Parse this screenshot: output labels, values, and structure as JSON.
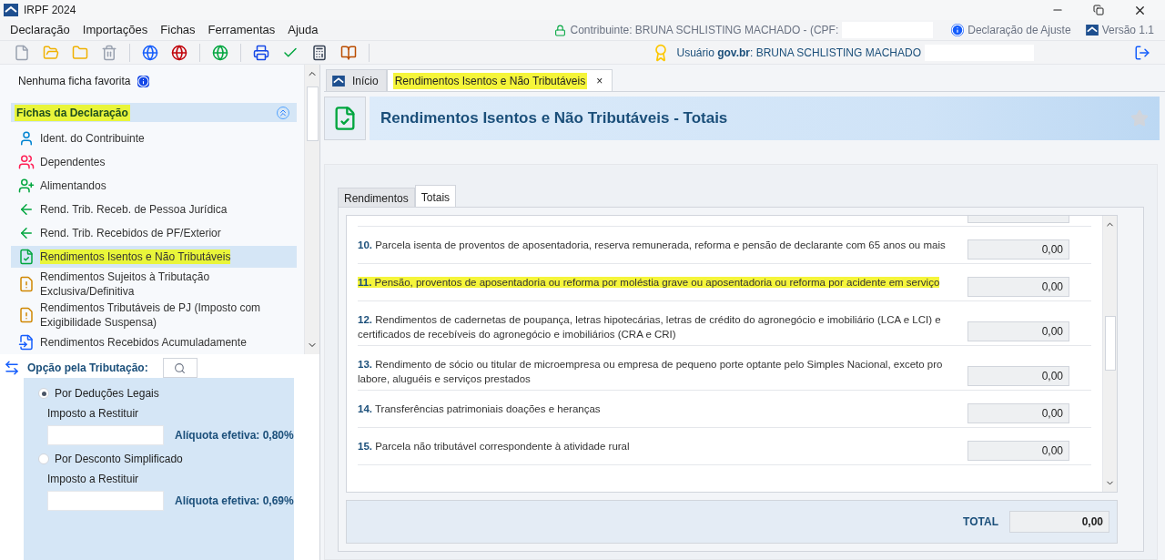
{
  "window": {
    "title": "IRPF 2024"
  },
  "menu": [
    "Declaração",
    "Importações",
    "Fichas",
    "Ferramentas",
    "Ajuda"
  ],
  "toolbar": [
    {
      "kind": "new"
    },
    {
      "kind": "open"
    },
    {
      "kind": "folder"
    },
    {
      "kind": "trash"
    },
    {
      "kind": "sep"
    },
    {
      "kind": "globe"
    },
    {
      "kind": "globe2"
    },
    {
      "kind": "sep"
    },
    {
      "kind": "earth"
    },
    {
      "kind": "sep"
    },
    {
      "kind": "print"
    },
    {
      "kind": "check"
    },
    {
      "kind": "calc"
    },
    {
      "kind": "book"
    },
    {
      "kind": "sep"
    }
  ],
  "status": {
    "contribuinte": "Contribuinte: BRUNA SCHLISTING MACHADO - (CPF:",
    "declaracao": "Declaração de Ajuste",
    "versao": "Versão 1.1",
    "usuario": "Usuário **gov.br**: BRUNA SCHLISTING MACHADO"
  },
  "sidebar": {
    "favorites": "Nenhuma ficha favorita",
    "section": {
      "title": "Fichas da Declaração",
      "highlighted": true,
      "expanded": true
    },
    "items": [
      {
        "label": "Ident. do Contribuinte",
        "kind": "person",
        "selected": false,
        "highlighted": false
      },
      {
        "label": "Dependentes",
        "kind": "people",
        "selected": false,
        "highlighted": false
      },
      {
        "label": "Alimentandos",
        "kind": "people-add",
        "selected": false,
        "highlighted": false
      },
      {
        "label": "Rend. Trib. Receb. de Pessoa Jurídica",
        "kind": "arrow-person",
        "selected": false,
        "highlighted": false
      },
      {
        "label": "Rend. Trib. Recebidos de PF/Exterior",
        "kind": "arrow-person",
        "selected": false,
        "highlighted": false
      },
      {
        "label": "Rendimentos Isentos e Não Tributáveis",
        "kind": "doc-check",
        "selected": true,
        "highlighted": true
      },
      {
        "label": "Rendimentos Sujeitos à Tributação Exclusiva/Definitiva",
        "kind": "doc-warn",
        "selected": false,
        "highlighted": false
      },
      {
        "label": "Rendimentos Tributáveis de PJ (Imposto com Exigibilidade Suspensa)",
        "kind": "arrow-warn",
        "selected": false,
        "highlighted": false
      },
      {
        "label": "Rendimentos Recebidos Acumuladamente",
        "kind": "doc-back",
        "selected": false,
        "highlighted": false
      }
    ]
  },
  "opcao": {
    "title": "Opção pela Tributação:",
    "options": [
      {
        "label": "Por Deduções Legais",
        "selected": true,
        "field_label": "Imposto a Restituir",
        "aliquota": "Alíquota efetiva: 0,80%"
      },
      {
        "label": "Por Desconto Simplificado",
        "selected": false,
        "field_label": "Imposto a Restituir",
        "aliquota": "Alíquota efetiva: 0,69%"
      }
    ]
  },
  "tabs": [
    {
      "label": "Início",
      "selected": false,
      "highlighted": false,
      "closable": false
    },
    {
      "label": "Rendimentos Isentos e Não Tributáveis",
      "selected": true,
      "highlighted": true,
      "closable": true
    }
  ],
  "close_glyph": "×",
  "page": {
    "title": "Rendimentos Isentos e Não Tributáveis - Totais",
    "subtabs": [
      {
        "label": "Rendimentos",
        "selected": false
      },
      {
        "label": "Totais",
        "selected": true
      }
    ],
    "rows": [
      {
        "number": "10.",
        "text": "Parcela isenta de proventos de aposentadoria, reserva remunerada, reforma e pensão de declarante com 65 anos ou mais",
        "value": "0,00",
        "highlighted": false
      },
      {
        "number": "11.",
        "text": "Pensão, proventos de aposentadoria ou reforma por moléstia grave ou aposentadoria ou reforma por acidente em serviço",
        "value": "0,00",
        "highlighted": true
      },
      {
        "number": "12.",
        "text": "Rendimentos de cadernetas de poupança, letras hipotecárias, letras de crédito do agronegócio e imobiliário (LCA e LCI) e certificados de recebíveis do agronegócio e imobiliários (CRA e CRI)",
        "value": "0,00",
        "highlighted": false
      },
      {
        "number": "13.",
        "text": "Rendimento de sócio ou titular de microempresa ou empresa de pequeno porte optante pelo Simples Nacional, exceto pro labore, aluguéis e serviços prestados",
        "value": "0,00",
        "highlighted": false
      },
      {
        "number": "14.",
        "text": "Transferências patrimoniais doações e heranças",
        "value": "0,00",
        "highlighted": false
      },
      {
        "number": "15.",
        "text": "Parcela não tributável correspondente à atividade rural",
        "value": "0,00",
        "highlighted": false
      }
    ],
    "total": {
      "label": "TOTAL",
      "value": "0,00"
    }
  }
}
